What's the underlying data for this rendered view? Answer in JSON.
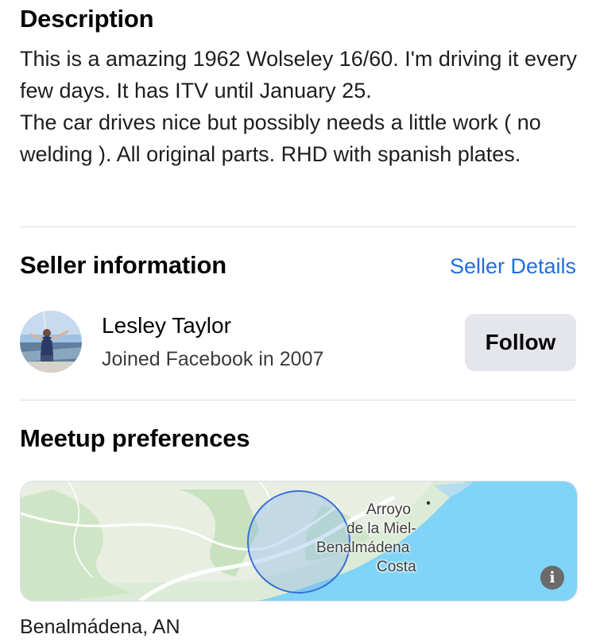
{
  "description": {
    "heading": "Description",
    "paragraphs": [
      "This is a amazing 1962 Wolseley 16/60. I'm driving it every few days. It has  ITV until January 25.",
      "The car drives nice but possibly needs a little work ( no welding ). All original parts. RHD with spanish plates."
    ]
  },
  "seller": {
    "heading": "Seller information",
    "details_link": "Seller Details",
    "name": "Lesley Taylor",
    "joined": "Joined Facebook in 2007",
    "follow_label": "Follow",
    "avatar_icon": "avatar"
  },
  "meetup": {
    "heading": "Meetup preferences",
    "map_labels": {
      "line1": "Arroyo",
      "line2": "de la Miel-",
      "line3": "Benalmádena",
      "line4": "Costa"
    },
    "info_icon": "info-icon",
    "location": "Benalmádena, AN"
  },
  "colors": {
    "link": "#216fdb",
    "button_bg": "#e4e6eb",
    "sea": "#7fd4f7",
    "land": "#d8ead2",
    "radius_circle": "#3b6fd6"
  }
}
